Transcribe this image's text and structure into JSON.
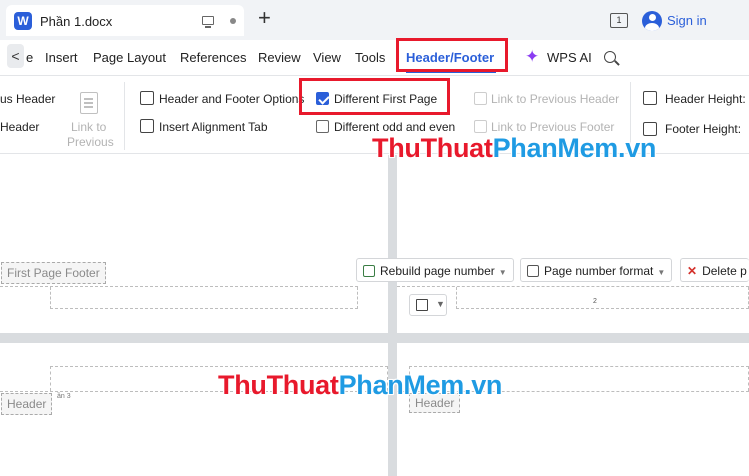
{
  "titlebar": {
    "logo_letter": "W",
    "document_name": "Phần 1.docx",
    "pages_badge": "1",
    "sign_in": "Sign in"
  },
  "menu": {
    "back": "<",
    "items": [
      "e",
      "Insert",
      "Page Layout",
      "References",
      "Review",
      "View",
      "Tools",
      "Header/Footer",
      "WPS AI"
    ],
    "active": "Header/Footer"
  },
  "ribbon": {
    "previous_header": "us Header",
    "header": "Header",
    "link_to_previous": [
      "Link to",
      "Previous"
    ],
    "header_footer_options": "Header and Footer Options",
    "insert_alignment_tab": "Insert Alignment Tab",
    "different_first_page": {
      "label": "Different First Page",
      "checked": true
    },
    "different_odd_even": {
      "label": "Different odd and even",
      "checked": false
    },
    "link_to_previous_header": "Link to Previous Header",
    "link_to_previous_footer": "Link to Previous Footer",
    "header_height": "Header Height:",
    "footer_height": "Footer Height:"
  },
  "document": {
    "first_page_footer_tag": "First Page Footer",
    "rebuild_page_number": "Rebuild page number",
    "page_number_format": "Page number format",
    "delete_label": "Delete p",
    "page_number": "2",
    "header_tag_left": "Header",
    "header_tag_right": "Header",
    "faint_text": "ần 3"
  },
  "watermark": {
    "part1": "Thu",
    "part2": "Thuat",
    "part3": "PhanMem",
    "part4": ".vn"
  },
  "colors": {
    "accent": "#2b5fd9",
    "highlight_box": "#e8192c",
    "watermark_red": "#e8192c",
    "watermark_blue": "#1f9be3"
  }
}
